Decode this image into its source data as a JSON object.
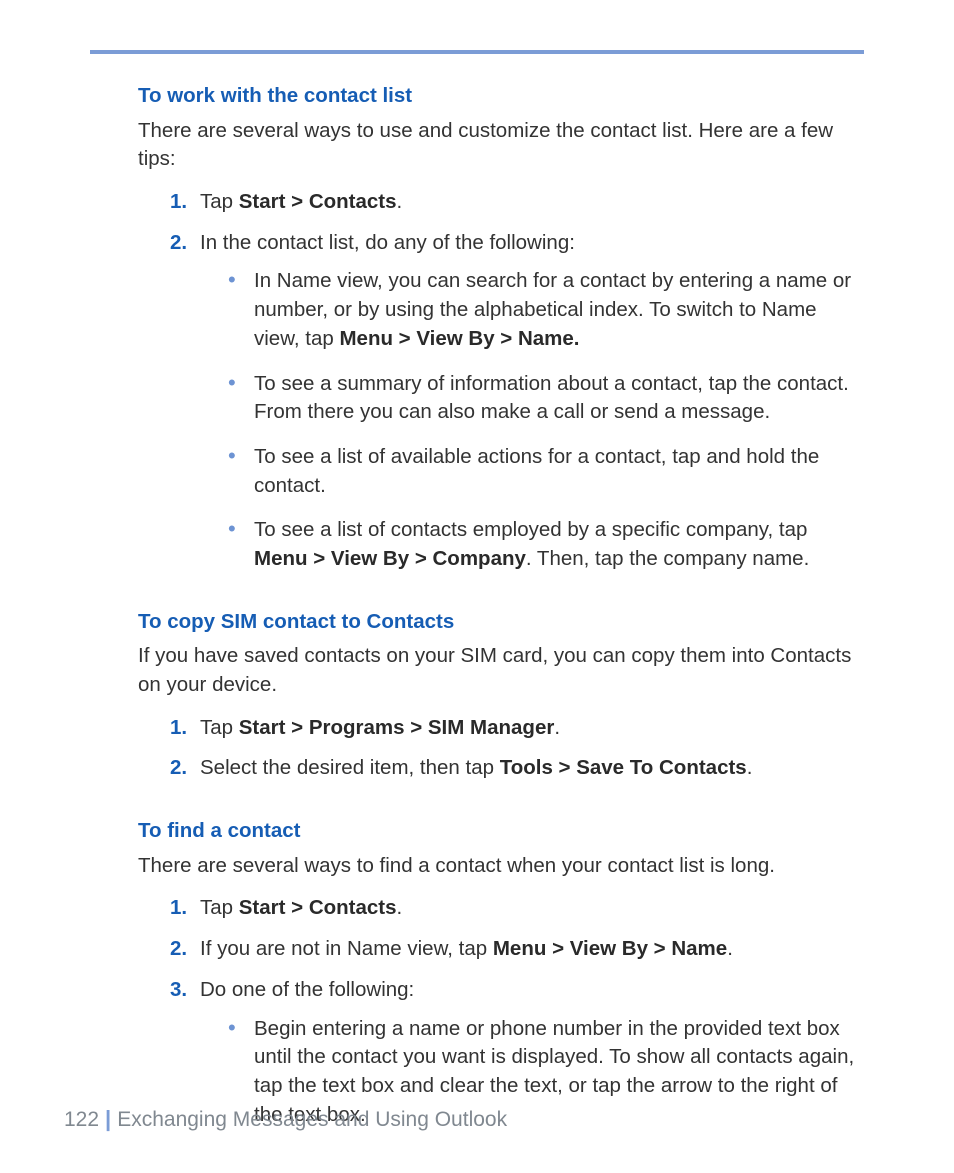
{
  "section1": {
    "title": "To work with the contact list",
    "intro": "There are several ways to use and customize the contact list. Here are a few tips:",
    "step1_num": "1.",
    "step1_a": "Tap ",
    "step1_b": "Start > Contacts",
    "step1_c": ".",
    "step2_num": "2.",
    "step2": "In the contact list, do any of the following:",
    "b1_a": "In Name view, you can search for a contact by entering a name or number, or by using the alphabetical index. To switch to Name view, tap ",
    "b1_b": "Menu > View By > Name.",
    "b2": "To see a summary of information about a contact, tap the contact. From there you can also make a call or send a message.",
    "b3": "To see a list of available actions for a contact, tap and hold the contact.",
    "b4_a": "To see a list of contacts employed by a specific company, tap ",
    "b4_b": "Menu > View By > Company",
    "b4_c": ". Then, tap the company name."
  },
  "section2": {
    "title": "To copy SIM contact to Contacts",
    "intro": "If you have saved contacts on your SIM card, you can copy them into Contacts on your device.",
    "step1_num": "1.",
    "step1_a": "Tap ",
    "step1_b": "Start > Programs > SIM Manager",
    "step1_c": ".",
    "step2_num": "2.",
    "step2_a": "Select the desired item, then tap ",
    "step2_b": "Tools > Save To Contacts",
    "step2_c": "."
  },
  "section3": {
    "title": "To find a contact",
    "intro": "There are several ways to find a contact when your contact list is long.",
    "step1_num": "1.",
    "step1_a": "Tap ",
    "step1_b": "Start > Contacts",
    "step1_c": ".",
    "step2_num": "2.",
    "step2_a": "If you are not in Name view, tap ",
    "step2_b": "Menu > View By > Name",
    "step2_c": ".",
    "step3_num": "3.",
    "step3": "Do one of the following:",
    "b1": "Begin entering a name or phone number in the provided text box until the contact you want is displayed. To show all contacts again, tap the text box and clear the text, or tap the arrow to the right of the text box."
  },
  "footer": {
    "page_number": "122",
    "chapter": "Exchanging Messages and Using Outlook"
  }
}
